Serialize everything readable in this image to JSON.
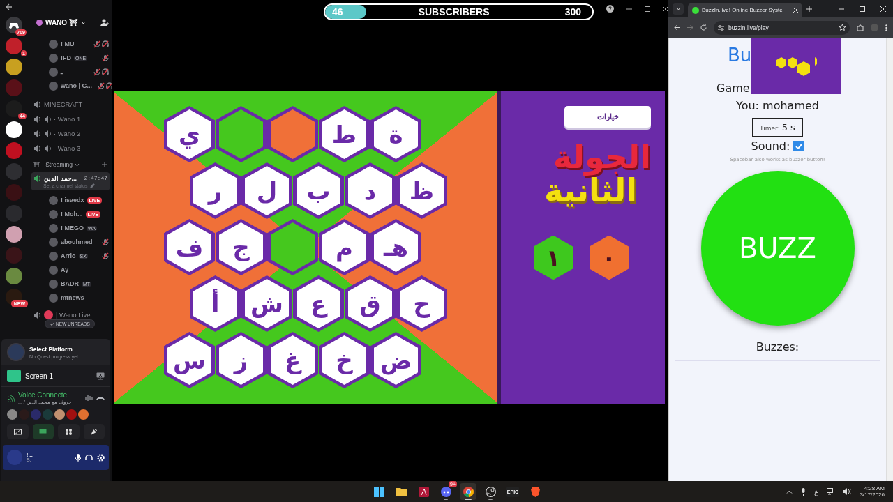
{
  "discord": {
    "servers": [
      {
        "color": "#3a3a3e",
        "badge": "709"
      },
      {
        "color": "#c0202a",
        "badge": "1"
      },
      {
        "color": "#c8a020"
      },
      {
        "color": "#5a1018"
      },
      {
        "color": "#1c1c1c",
        "badge": "44"
      },
      {
        "color": "#ffffff"
      },
      {
        "color": "#c01020"
      },
      {
        "color": "#2e2e32"
      },
      {
        "color": "#3a1014"
      },
      {
        "color": "#2a2a2e"
      },
      {
        "color": "#d0a0b0"
      },
      {
        "color": "#3a1418"
      },
      {
        "color": "#6a8a40"
      },
      {
        "color": "#2a1a10",
        "badge": "NEW"
      }
    ],
    "server_name": "WANO ⛩",
    "top_members": [
      {
        "name": "! MU",
        "muted": true,
        "deafened": true
      },
      {
        "name": "!FD",
        "tag": "ONE",
        "muted": true,
        "deafened": false
      },
      {
        "name": "ـ",
        "muted": true,
        "deafened": true
      },
      {
        "name": "wano | G...",
        "muted": true,
        "deafened": true
      }
    ],
    "channels": [
      {
        "name": "MINECRAFT",
        "kind": "voice"
      },
      {
        "name": "· Wano 1",
        "kind": "voice-bullet"
      },
      {
        "name": "· Wano 2",
        "kind": "voice-bullet"
      },
      {
        "name": "· Wano 3",
        "kind": "voice-bullet"
      }
    ],
    "category": "· Streaming",
    "active_channel": {
      "name": "حمد الدين...",
      "timer": "2:47:47",
      "status": "Set a channel status"
    },
    "stream_members": [
      {
        "name": "! isaedx",
        "badge": "LIVE",
        "muted": false
      },
      {
        "name": "! Moh...",
        "badge": "LIVE",
        "muted": false
      },
      {
        "name": "! MEGO",
        "tag": "WA",
        "muted": false
      },
      {
        "name": "abouhmed",
        "muted": true
      },
      {
        "name": "Arrio",
        "tag": "SX",
        "muted": true
      },
      {
        "name": "Ay",
        "muted": false
      },
      {
        "name": "BADR",
        "tag": "MT",
        "muted": false
      },
      {
        "name": "mtnews",
        "muted": false
      }
    ],
    "after_channels": [
      {
        "name": "| Wano Live"
      }
    ],
    "unreads": "NEW UNREADS",
    "quest": {
      "title": "Select Platform",
      "subtitle": "No Quest progress yet"
    },
    "screen_share": "Screen 1",
    "voice": {
      "status": "Voice Connecte",
      "channel": "... / حروف مع محمد الدين"
    },
    "voice_avatars": [
      {
        "color": "#888888"
      },
      {
        "color": "#2a1a1a"
      },
      {
        "color": "#2a2a6a"
      },
      {
        "color": "#1a3a3a"
      },
      {
        "color": "#c09070"
      },
      {
        "color": "#a01010"
      },
      {
        "color": "#e07030"
      }
    ],
    "user": {
      "name": "! ...",
      "status": "S."
    }
  },
  "stream_overlay": {
    "current": "46",
    "label": "SUBSCRIBERS",
    "goal": "300",
    "level": 0.153
  },
  "game": {
    "options_button": "خيارات",
    "round_title": [
      "الجولة",
      "الثانية"
    ],
    "scores": [
      {
        "value": "٠",
        "color": "#f07030"
      },
      {
        "value": "١",
        "color": "#3ec81e"
      }
    ],
    "board": [
      [
        {
          "kind": "letter",
          "letter": "ة"
        },
        {
          "kind": "letter",
          "letter": "ط"
        },
        {
          "kind": "claimed",
          "color": "#f07038"
        },
        {
          "kind": "claimed",
          "color": "#45c81e"
        },
        {
          "kind": "letter",
          "letter": "ي"
        }
      ],
      [
        {
          "kind": "letter",
          "letter": "ظ"
        },
        {
          "kind": "letter",
          "letter": "د"
        },
        {
          "kind": "letter",
          "letter": "ب"
        },
        {
          "kind": "letter",
          "letter": "ل"
        },
        {
          "kind": "letter",
          "letter": "ر"
        }
      ],
      [
        {
          "kind": "letter",
          "letter": "هـ"
        },
        {
          "kind": "letter",
          "letter": "م"
        },
        {
          "kind": "claimed",
          "color": "#45c81e"
        },
        {
          "kind": "letter",
          "letter": "ج"
        },
        {
          "kind": "letter",
          "letter": "ف"
        }
      ],
      [
        {
          "kind": "letter",
          "letter": "ح"
        },
        {
          "kind": "letter",
          "letter": "ق"
        },
        {
          "kind": "letter",
          "letter": "ع"
        },
        {
          "kind": "letter",
          "letter": "ش"
        },
        {
          "kind": "letter",
          "letter": "أ"
        }
      ],
      [
        {
          "kind": "letter",
          "letter": "ض"
        },
        {
          "kind": "letter",
          "letter": "خ"
        },
        {
          "kind": "letter",
          "letter": "غ"
        },
        {
          "kind": "letter",
          "letter": "ز"
        },
        {
          "kind": "letter",
          "letter": "س"
        }
      ]
    ]
  },
  "browser": {
    "tab_title": "BuzzIn.live! Online Buzzer Syste",
    "url": "buzzin.live/play",
    "page": {
      "heading": "Bu",
      "game_label": "Game",
      "you": "You: mohamed",
      "timer_label": "Timer:",
      "timer_value": "5 s",
      "sound_label": "Sound:",
      "sound_checked": true,
      "hint": "Spacebar also works as buzzer button!",
      "buzz": "BUZZ",
      "buzzes": "Buzzes:"
    }
  },
  "taskbar": {
    "apps": [
      {
        "kind": "start",
        "selected": false,
        "running": false
      },
      {
        "kind": "folder",
        "selected": false,
        "running": false
      },
      {
        "kind": "affinity",
        "selected": false,
        "running": false
      },
      {
        "kind": "discord",
        "badge": "9+",
        "selected": false,
        "running": true
      },
      {
        "kind": "chrome",
        "selected": true,
        "running": true
      },
      {
        "kind": "steam",
        "selected": false,
        "running": true
      },
      {
        "kind": "epic",
        "label": "EPIC",
        "selected": false,
        "running": false
      },
      {
        "kind": "brave",
        "selected": false,
        "running": false
      }
    ],
    "tray": {
      "lang": "ع",
      "time": "4:28 AM",
      "date": "3/17/2026"
    }
  }
}
